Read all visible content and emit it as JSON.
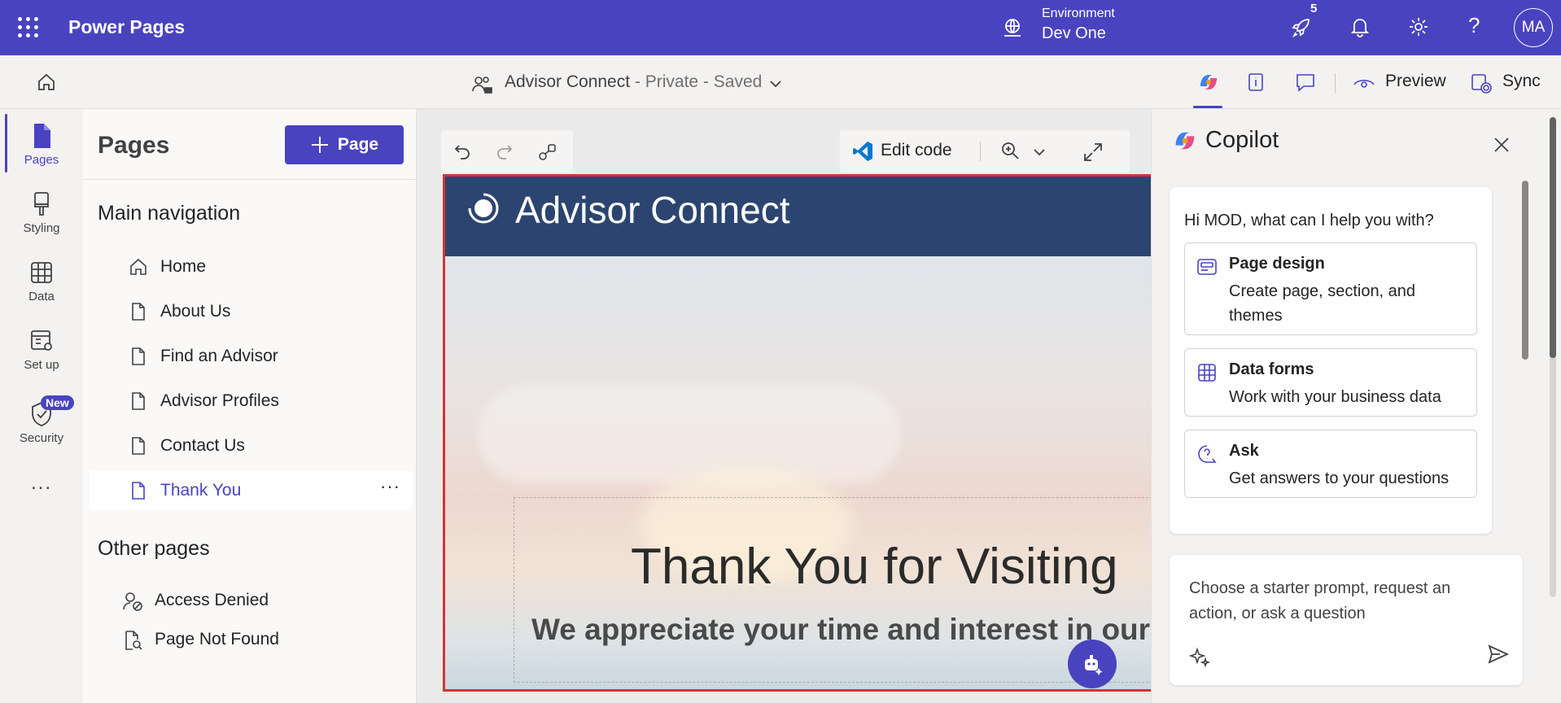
{
  "topbar": {
    "app_name": "Power Pages",
    "environment_label": "Environment",
    "environment_value": "Dev One",
    "notification_count": "5",
    "avatar_initials": "MA"
  },
  "cmdbar": {
    "site_name": "Advisor Connect",
    "site_status": " - Private - Saved",
    "preview_label": "Preview",
    "sync_label": "Sync"
  },
  "rail": {
    "items": [
      {
        "label": "Pages",
        "icon": "page-icon"
      },
      {
        "label": "Styling",
        "icon": "brush-icon"
      },
      {
        "label": "Data",
        "icon": "table-icon"
      },
      {
        "label": "Set up",
        "icon": "setup-icon"
      },
      {
        "label": "Security",
        "icon": "shield-icon"
      }
    ],
    "new_badge": "New",
    "more": "..."
  },
  "pages_pane": {
    "title": "Pages",
    "add_page_label": "Page",
    "main_nav_heading": "Main navigation",
    "main_nav": [
      {
        "label": "Home",
        "icon": "home-icon"
      },
      {
        "label": "About Us",
        "icon": "page-icon"
      },
      {
        "label": "Find an Advisor",
        "icon": "page-icon"
      },
      {
        "label": "Advisor Profiles",
        "icon": "page-icon"
      },
      {
        "label": "Contact Us",
        "icon": "page-icon"
      },
      {
        "label": "Thank You",
        "icon": "page-icon",
        "selected": true
      }
    ],
    "other_heading": "Other pages",
    "other_pages": [
      {
        "label": "Access Denied",
        "icon": "person-blocked-icon"
      },
      {
        "label": "Page Not Found",
        "icon": "page-search-icon"
      }
    ]
  },
  "canvas": {
    "edit_code_label": "Edit code",
    "site_header_name": "Advisor Connect",
    "hero_title": "Thank You for Visiting",
    "hero_subtitle": "We appreciate your time and interest in our s"
  },
  "copilot": {
    "title": "Copilot",
    "greeting": "Hi MOD, what can I help you with?",
    "suggestions": [
      {
        "title": "Page design",
        "desc": "Create page, section, and themes",
        "icon": "page-design-icon"
      },
      {
        "title": "Data forms",
        "desc": "Work with your business data",
        "icon": "grid-icon"
      },
      {
        "title": "Ask",
        "desc": "Get answers to your questions",
        "icon": "question-chat-icon"
      }
    ],
    "input_placeholder": "Choose a starter prompt, request an action, or ask a question"
  },
  "colors": {
    "brand": "#4a43c0",
    "site_header": "#2c4570",
    "selection_border": "#d13438"
  }
}
